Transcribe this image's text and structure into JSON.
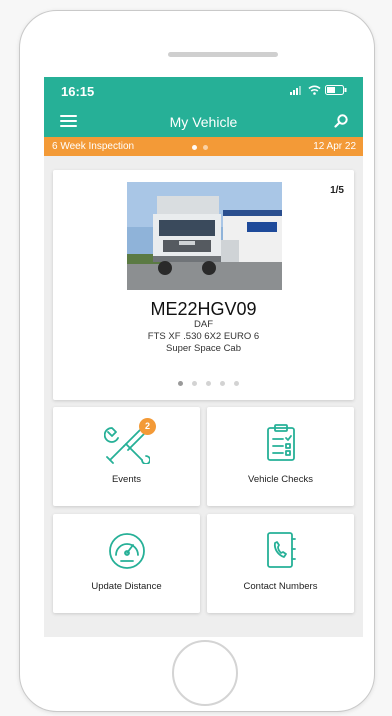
{
  "status_bar": {
    "time": "16:15"
  },
  "app_bar": {
    "title": "My Vehicle",
    "menu_icon": "hamburger-menu-icon",
    "search_icon": "search-icon"
  },
  "inspection": {
    "label": "6 Week Inspection",
    "date": "12 Apr 22"
  },
  "vehicle": {
    "photo_counter": "1/5",
    "registration": "ME22HGV09",
    "make": "DAF",
    "model": "FTS XF .530 6X2 EURO 6",
    "cab": "Super Space Cab"
  },
  "tiles": [
    {
      "label": "Events",
      "icon": "wrench-screwdriver-icon",
      "badge": "2"
    },
    {
      "label": "Vehicle Checks",
      "icon": "clipboard-checklist-icon"
    },
    {
      "label": "Update Distance",
      "icon": "speedometer-icon"
    },
    {
      "label": "Contact Numbers",
      "icon": "phone-book-icon"
    }
  ],
  "colors": {
    "accent": "#26b097",
    "banner": "#f39a37"
  }
}
